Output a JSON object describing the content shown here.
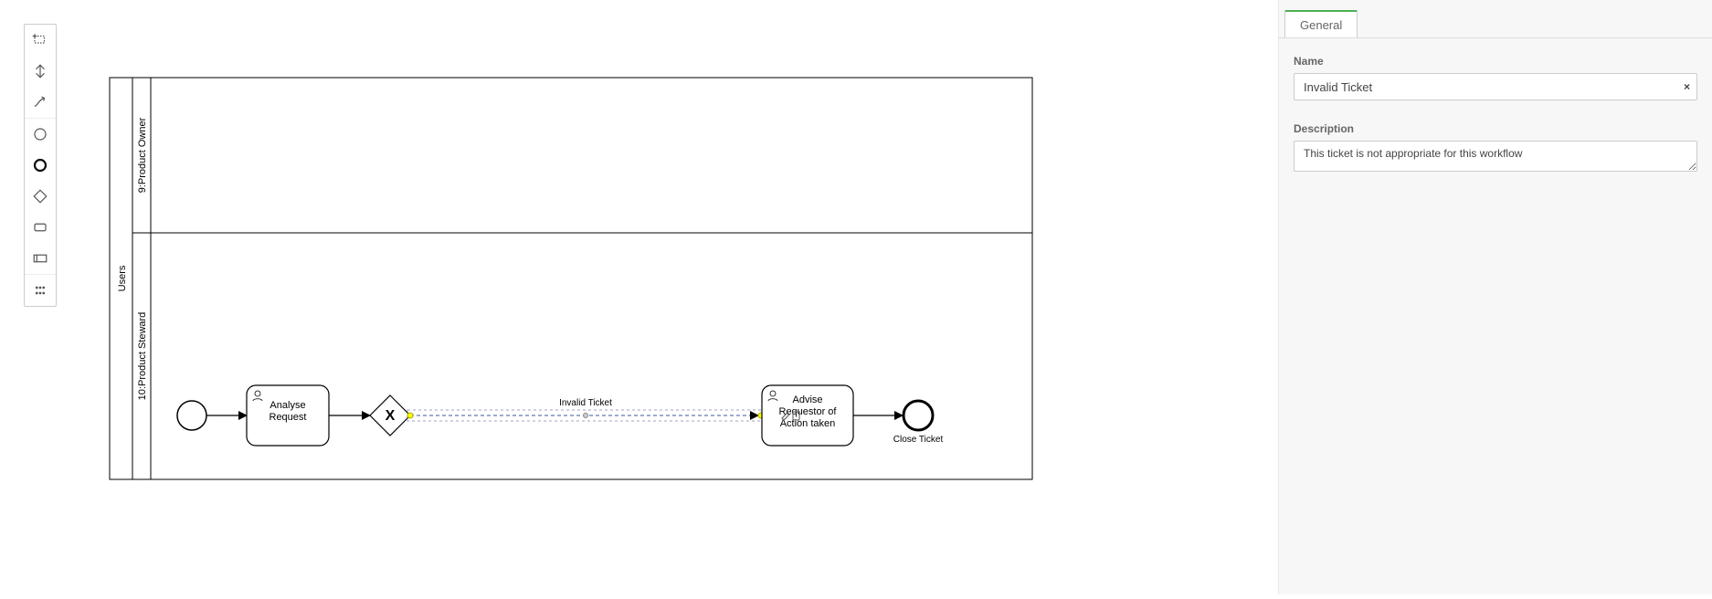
{
  "panel": {
    "tab_general": "General",
    "name_label": "Name",
    "name_value": "Invalid Ticket",
    "clear_glyph": "×",
    "desc_label": "Description",
    "desc_value": "This ticket is not appropriate for this workflow"
  },
  "diagram": {
    "pool_label": "Users",
    "lane1_label": "9:Product Owner",
    "lane2_label": "10:Product Steward",
    "task_analyse": "Analyse\nRequest",
    "task_advise": "Advise\nRequestor of\nAction taken",
    "flow_invalid": "Invalid Ticket",
    "end_label": "Close Ticket"
  },
  "palette": {
    "tool_hand": "hand-tool",
    "tool_lasso": "lasso-tool",
    "tool_space": "space-tool",
    "tool_connect": "connect-tool",
    "tool_start": "start-event-tool",
    "tool_end": "end-event-tool",
    "tool_gateway": "gateway-tool",
    "tool_task": "task-tool",
    "tool_pool": "pool-tool",
    "tool_data": "data-object-tool"
  }
}
